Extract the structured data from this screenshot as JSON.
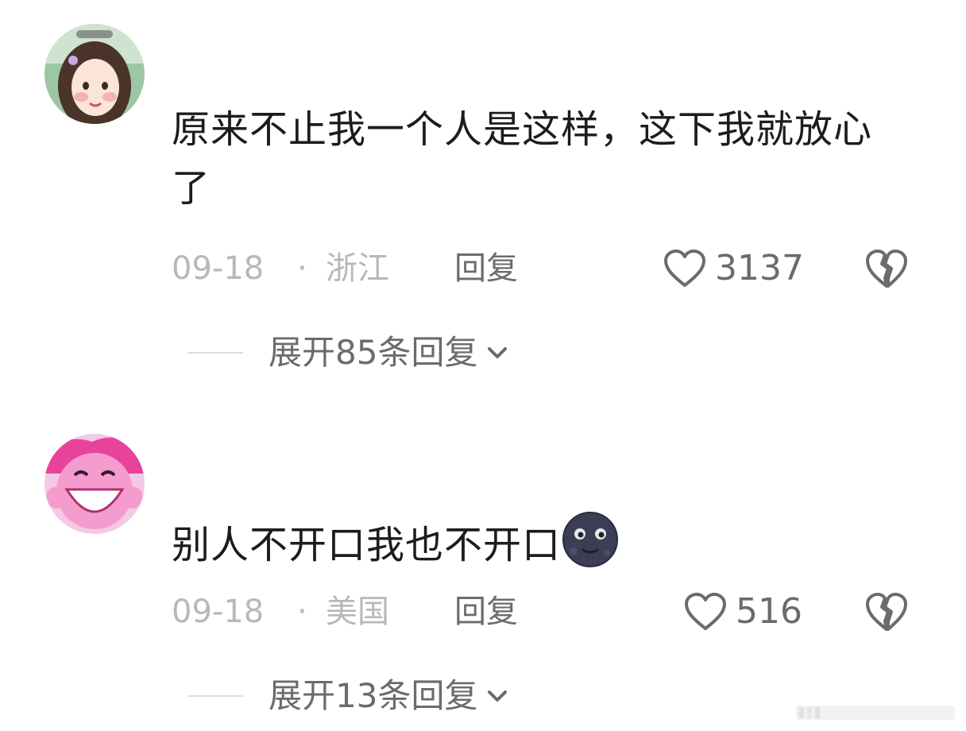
{
  "comments": [
    {
      "avatar": "girl-avatar",
      "text": "原来不止我一个人是这样，这下我就放心了",
      "date": "09-18",
      "separator": "·",
      "region": "浙江",
      "reply_label": "回复",
      "likes": "3137",
      "expand_label": "展开85条回复",
      "icons": [
        "heart-icon",
        "broken-heart-icon",
        "chevron-down-icon"
      ]
    },
    {
      "avatar": "pink-pony-avatar",
      "text": "别人不开口我也不开口",
      "emoji": "new-moon-face-emoji",
      "date": "09-18",
      "separator": "·",
      "region": "美国",
      "reply_label": "回复",
      "likes": "516",
      "expand_label": "展开13条回复",
      "icons": [
        "heart-icon",
        "broken-heart-icon",
        "chevron-down-icon"
      ]
    }
  ],
  "colors": {
    "text": "#1c1c1c",
    "meta": "#b8b8b8",
    "action": "#6b6b6b",
    "background": "#ffffff"
  }
}
